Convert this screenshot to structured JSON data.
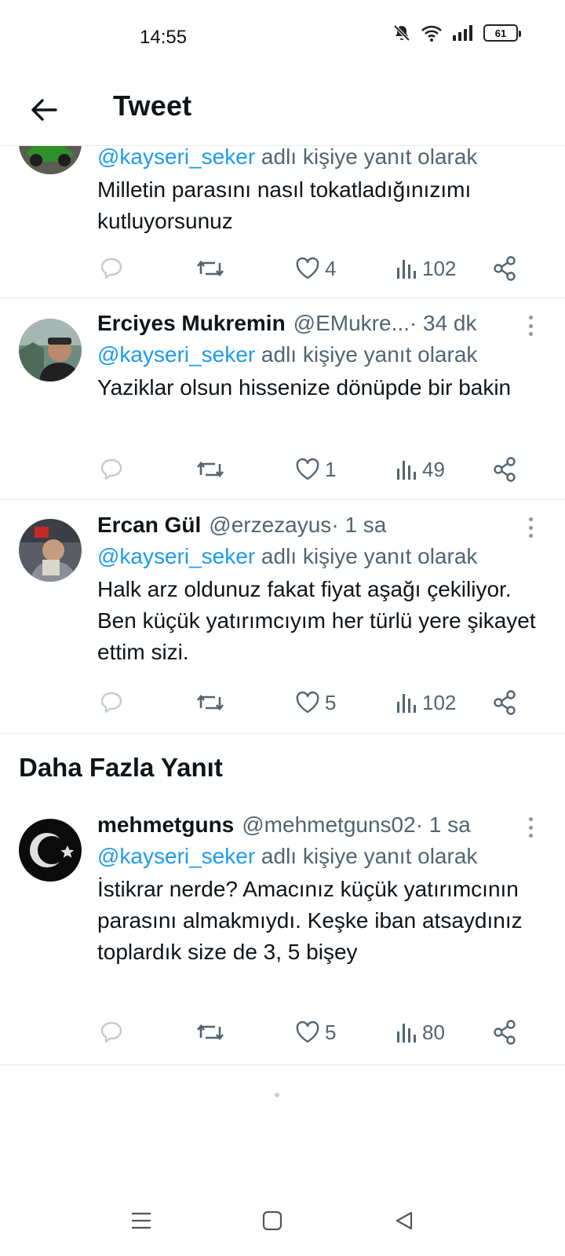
{
  "status_bar": {
    "time": "14:55",
    "battery": "61",
    "icons": [
      "mute-icon",
      "wifi-icon",
      "signal-icon",
      "battery-icon"
    ]
  },
  "header": {
    "title": "Tweet",
    "back_icon": "arrow-left-icon"
  },
  "tweets": [
    {
      "name": "",
      "handle": "",
      "time": "",
      "reply_prefix": "@kayseri_seker",
      "reply_suffix": " adlı kişiye yanıt olarak",
      "text": "Milletin parasını nasıl tokatladığınızımı kutluyorsunuz",
      "likes": "4",
      "views": "102"
    },
    {
      "name": "Erciyes Mukremin",
      "handle": "@EMukre...",
      "time": " · 34 dk",
      "reply_prefix": "@kayseri_seker",
      "reply_suffix": " adlı kişiye yanıt olarak",
      "text": "Yaziklar olsun hissenize dönüpde bir bakin",
      "likes": "1",
      "views": "49"
    },
    {
      "name": "Ercan Gül",
      "handle": "@erzezayus",
      "time": " · 1 sa",
      "reply_prefix": "@kayseri_seker",
      "reply_suffix": " adlı kişiye yanıt olarak",
      "text": "Halk arz oldunuz fakat fiyat aşağı çekiliyor. Ben küçük yatırımcıyım her türlü yere şikayet ettim sizi.",
      "likes": "5",
      "views": "102"
    },
    {
      "name": "mehmetguns",
      "handle": "@mehmetguns02",
      "time": " · 1 sa",
      "reply_prefix": "@kayseri_seker",
      "reply_suffix": " adlı kişiye yanıt olarak",
      "text": "İstikrar nerde? Amacınız küçük yatırımcının parasını almakmıydı. Keşke iban atsaydınız toplardık size de 3, 5 bişey",
      "likes": "5",
      "views": "80"
    }
  ],
  "more_replies_title": "Daha Fazla Yanıt",
  "colors": {
    "accent": "#1d9bf0",
    "text": "#0f1419",
    "secondary": "#536471",
    "divider": "#e6e9ec"
  },
  "nav_icons": [
    "menu-icon",
    "home-square-icon",
    "back-triangle-icon"
  ]
}
